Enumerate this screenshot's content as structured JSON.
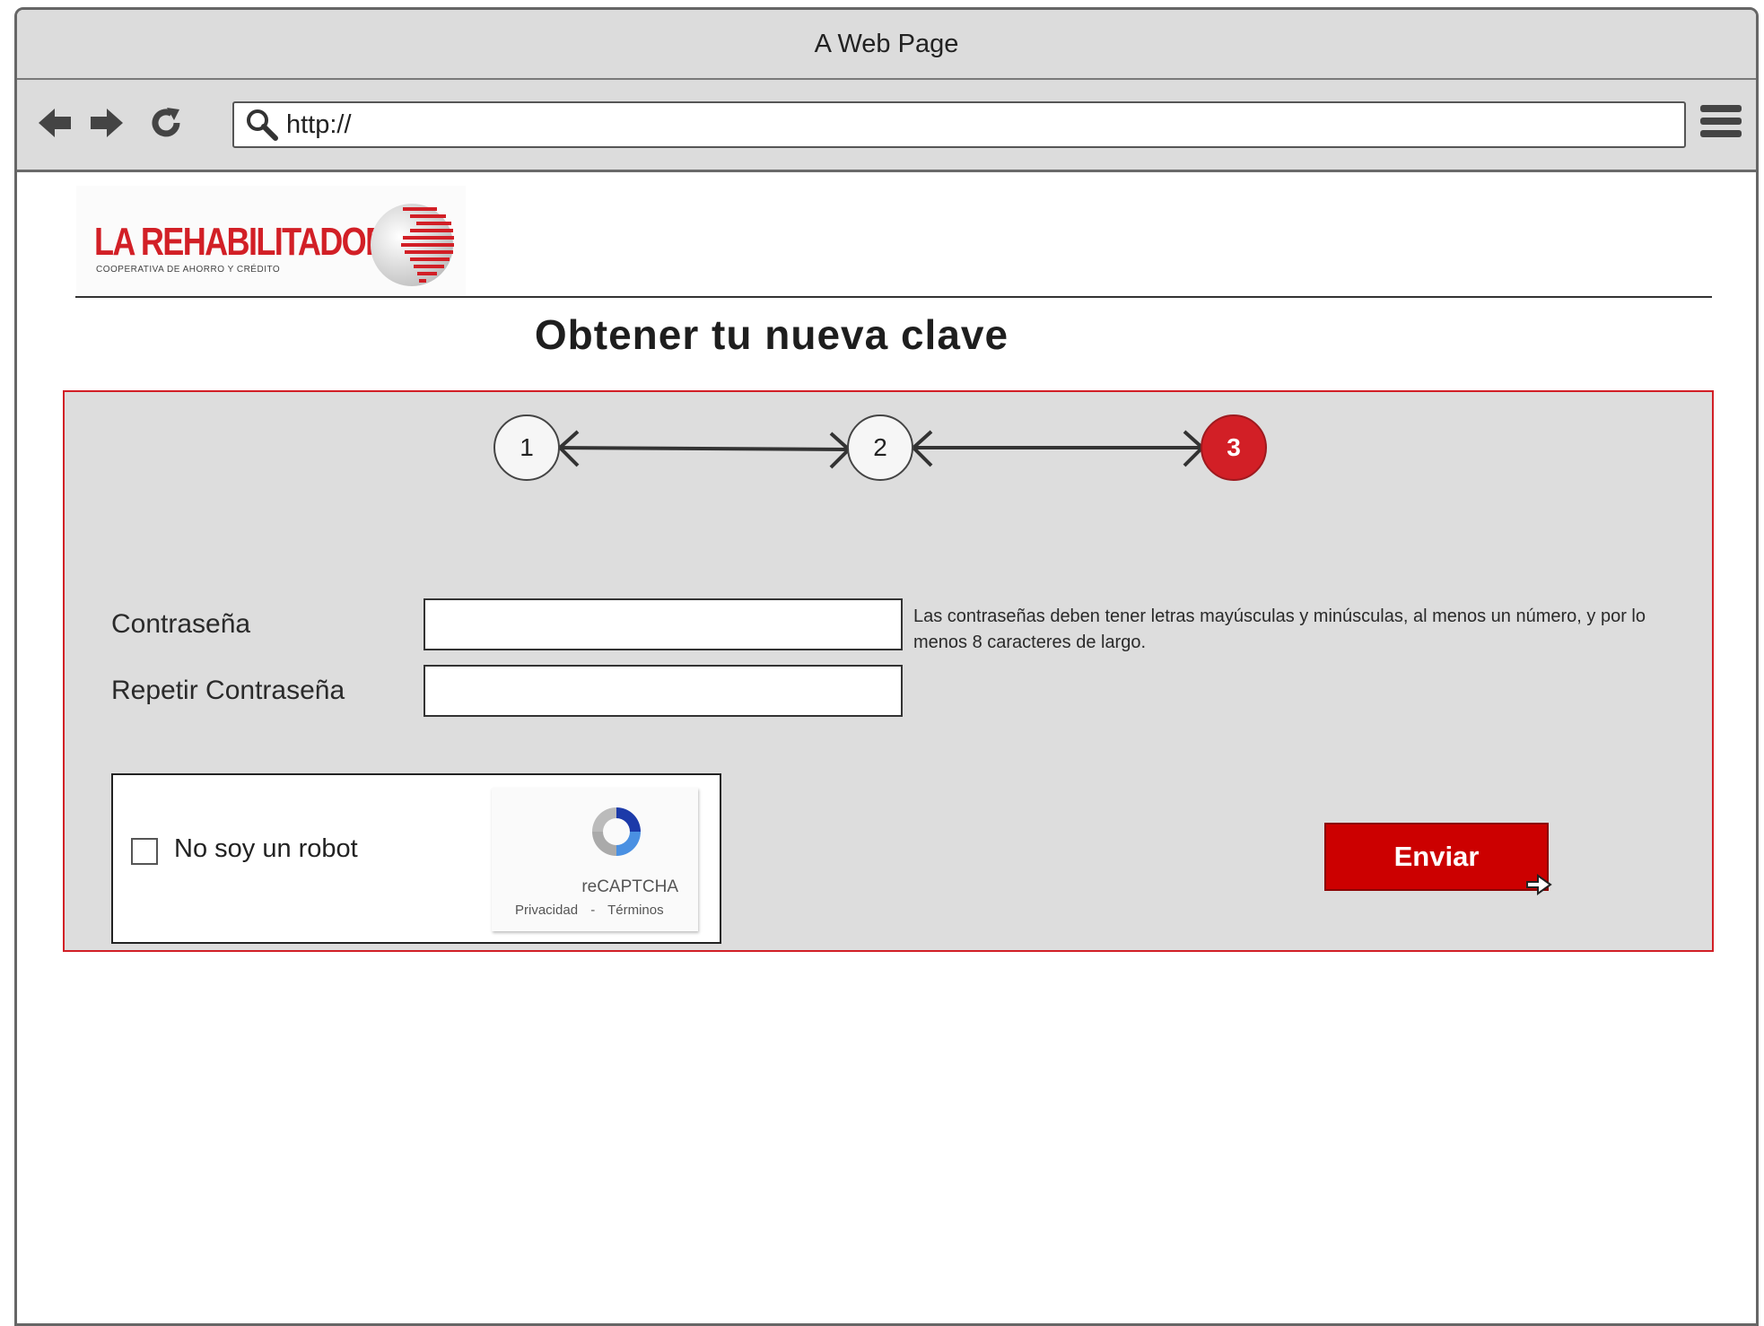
{
  "window": {
    "title": "A Web Page"
  },
  "browser": {
    "back_icon": "arrow-left-icon",
    "forward_icon": "arrow-right-icon",
    "reload_icon": "reload-icon",
    "url": "http://",
    "search_icon": "search-icon",
    "menu_icon": "hamburger-menu-icon"
  },
  "logo": {
    "name": "LA REHABILITADORA",
    "subtitle": "COOPERATIVA DE AHORRO Y CRÉDITO"
  },
  "page": {
    "title": "Obtener tu nueva clave"
  },
  "steps": {
    "items": [
      {
        "label": "1",
        "state": "inactive"
      },
      {
        "label": "2",
        "state": "inactive"
      },
      {
        "label": "3",
        "state": "active"
      }
    ],
    "active_color": "#d21f26"
  },
  "form": {
    "password_label": "Contraseña",
    "password_value": "",
    "repeat_password_label": "Repetir Contraseña",
    "repeat_password_value": "",
    "hint": "Las contraseñas deben tener letras mayúsculas y minúsculas, al menos un número, y por lo menos 8 caracteres de largo."
  },
  "captcha": {
    "checkbox_label": "No soy un robot",
    "checked": false,
    "brand": "reCAPTCHA",
    "links": "Privacidad - Términos"
  },
  "submit": {
    "label": "Enviar",
    "color": "#cc0000"
  },
  "colors": {
    "brand_red": "#d21f26",
    "panel_bg": "#dddddd"
  }
}
